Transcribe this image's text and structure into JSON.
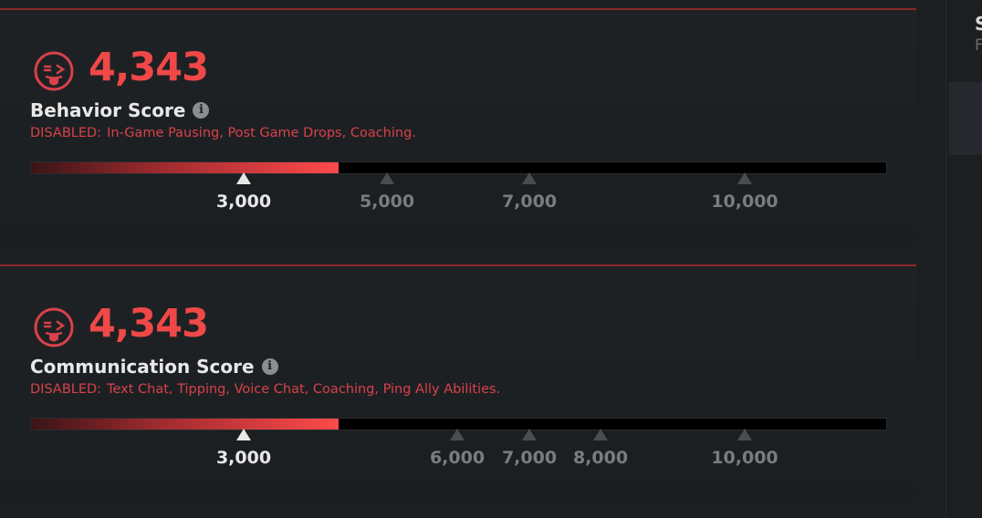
{
  "behavior": {
    "score": "4,343",
    "title": "Behavior Score",
    "disabled_label": "DISABLED:",
    "disabled_items": "In-Game Pausing, Post Game Drops, Coaching.",
    "progress": 0.36,
    "ticks": [
      "3,000",
      "5,000",
      "7,000",
      "10,000"
    ],
    "active_tick": "3,000"
  },
  "communication": {
    "score": "4,343",
    "title": "Communication Score",
    "disabled_label": "DISABLED:",
    "disabled_items": "Text Chat, Tipping, Voice Chat, Coaching, Ping Ally Abilities.",
    "progress": 0.36,
    "ticks": [
      "3,000",
      "6,000",
      "7,000",
      "8,000",
      "10,000"
    ],
    "active_tick": "3,000"
  },
  "right_panel": {
    "heading_initial": "S",
    "sub_initial": "F"
  },
  "colors": {
    "accent": "#f04848",
    "disabled_text": "#d8414a"
  },
  "icons": {
    "face": "tongue-out-face-icon",
    "info": "info-icon"
  }
}
